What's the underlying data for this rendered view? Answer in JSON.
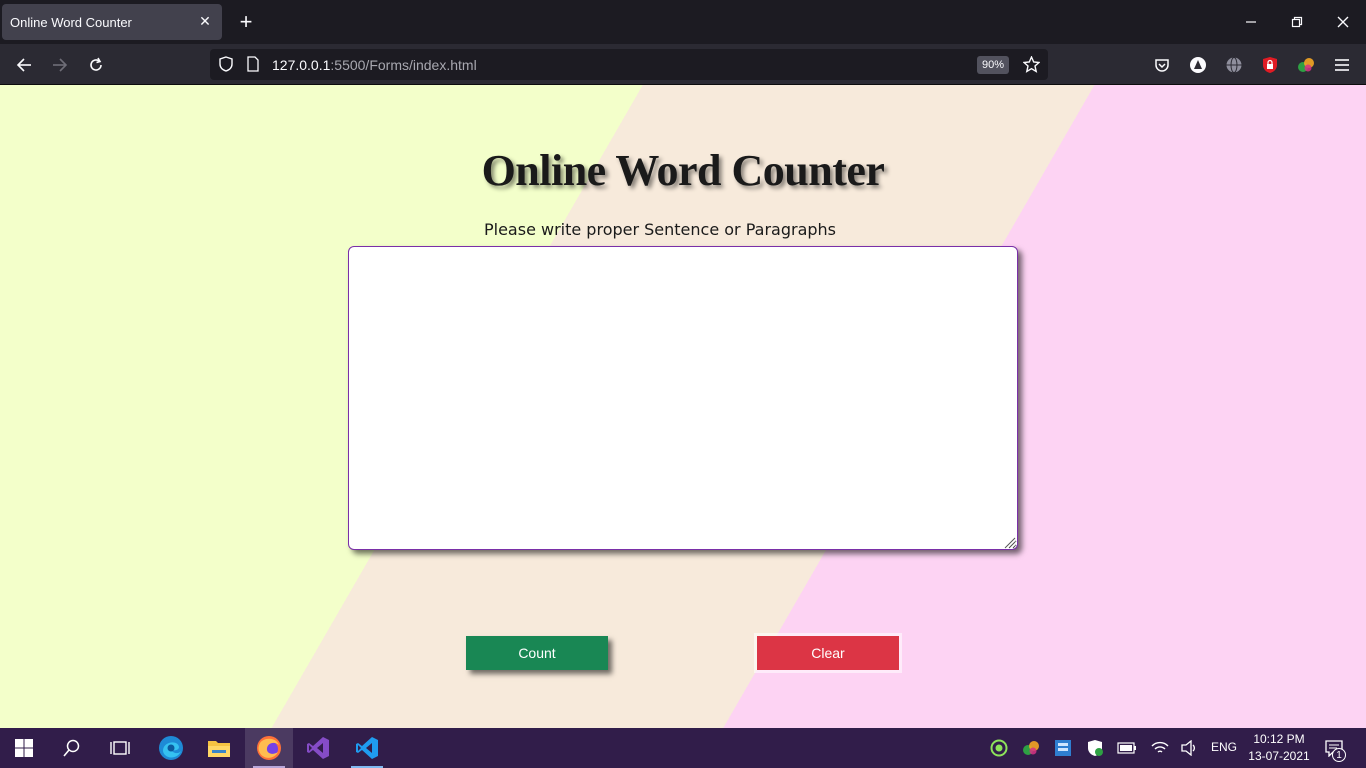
{
  "browser": {
    "tab_title": "Online Word Counter",
    "url_host": "127.0.0.1",
    "url_rest": ":5500/Forms/index.html",
    "zoom": "90%",
    "icons": [
      "back-icon",
      "forward-icon",
      "reload-icon",
      "shield-icon",
      "page-icon",
      "bookmark-star-icon",
      "pocket-icon",
      "extension-icon",
      "globe-icon",
      "ublock-icon",
      "colorful-extension-icon",
      "menu-icon"
    ]
  },
  "page": {
    "title": "Online Word Counter",
    "subtitle": "Please write proper Sentence or Paragraphs",
    "textarea_value": "",
    "count_label": "Count",
    "clear_label": "Clear",
    "colors": {
      "bg_left": "#f3ffca",
      "bg_mid": "#f7eadb",
      "bg_right": "#fdd3f3",
      "count": "#198754",
      "clear": "#dc3545"
    }
  },
  "taskbar": {
    "lang": "ENG",
    "time": "10:12 PM",
    "date": "13-07-2021",
    "notifications": "1",
    "apps": [
      "windows-start-icon",
      "search-icon",
      "task-view-icon",
      "edge-icon",
      "file-explorer-icon",
      "firefox-icon",
      "visual-studio-icon",
      "vscode-icon"
    ]
  }
}
